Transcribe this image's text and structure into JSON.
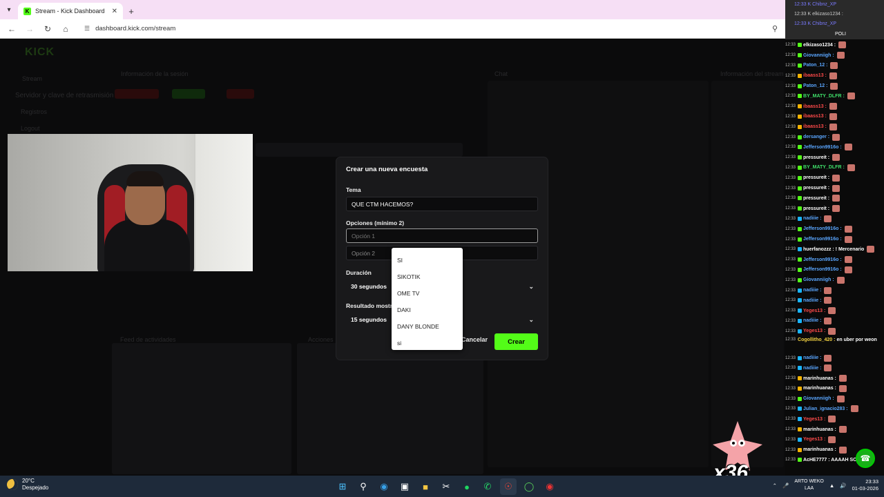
{
  "browser": {
    "tab_title": "Stream - Kick Dashboard",
    "tab_favicon": "K",
    "url": "dashboard.kick.com/stream"
  },
  "dashboard_bg": {
    "logo": "KICK",
    "nav_stream": "Stream",
    "nav_logs": "Registros",
    "nav_logout": "Logout",
    "stream_info": "Información de la sesión",
    "chat": "Chat",
    "stream_title": "Servidor y clave de retrasmisión",
    "activity_feed": "Feed de actividades",
    "actions": "Acciones",
    "stream_info_right": "Información del stream"
  },
  "modal": {
    "title": "Crear una nueva encuesta",
    "topic_label": "Tema",
    "topic_value": "QUE CTM HACEMOS?",
    "options_label": "Opciones (mínimo 2)",
    "option1_placeholder": "Opción 1",
    "option2_placeholder": "Opción 2",
    "duration_label": "Duración",
    "duration_value": "30 segundos",
    "result_label": "Resultado mostr",
    "result_value": "15 segundos",
    "cancel": "Cancelar",
    "create": "Crear"
  },
  "autocomplete": [
    "SI",
    "SIKOTIK",
    "OME TV",
    "DAKI",
    "DANY BLONDE",
    "si"
  ],
  "chat_overlay": {
    "top_lines": [
      "12:33 K  Chibnz_XP",
      "12:33 K  elkizaso1234 :",
      "12:33 K  Chibnz_XP"
    ],
    "top_badge": "POLI",
    "messages": [
      {
        "time": "12:33",
        "user": "elkizaso1234 :",
        "color": "#ffffff",
        "badge": "g"
      },
      {
        "time": "12:33",
        "user": "Giovanniigh :",
        "color": "#5aa6ff",
        "badge": "g"
      },
      {
        "time": "12:33",
        "user": "Paton_12 :",
        "color": "#5aa6ff",
        "badge": "g"
      },
      {
        "time": "12:33",
        "user": "ibaass13 :",
        "color": "#ff4a4a",
        "badge": "y"
      },
      {
        "time": "12:33",
        "user": "Paton_12 :",
        "color": "#5aa6ff",
        "badge": "g"
      },
      {
        "time": "12:33",
        "user": "BY_MATY_DLFR :",
        "color": "#3fe06a",
        "badge": "g"
      },
      {
        "time": "12:33",
        "user": "ibaass13 :",
        "color": "#ff4a4a",
        "badge": "y"
      },
      {
        "time": "12:33",
        "user": "ibaass13 :",
        "color": "#ff4a4a",
        "badge": "y"
      },
      {
        "time": "12:33",
        "user": "ibaass13 :",
        "color": "#ff4a4a",
        "badge": "y"
      },
      {
        "time": "12:33",
        "user": "dersanger :",
        "color": "#5aa6ff",
        "badge": "g"
      },
      {
        "time": "12:33",
        "user": "Jefferson9916o :",
        "color": "#5aa6ff",
        "badge": "g"
      },
      {
        "time": "12:33",
        "user": "pressureit :",
        "color": "#ffffff",
        "badge": "g"
      },
      {
        "time": "12:33",
        "user": "BY_MATY_DLFR :",
        "color": "#3fe06a",
        "badge": "g"
      },
      {
        "time": "12:33",
        "user": "pressureit :",
        "color": "#ffffff",
        "badge": "g"
      },
      {
        "time": "12:33",
        "user": "pressureit :",
        "color": "#ffffff",
        "badge": "g"
      },
      {
        "time": "12:33",
        "user": "pressureit :",
        "color": "#ffffff",
        "badge": "g"
      },
      {
        "time": "12:33",
        "user": "pressureit :",
        "color": "#ffffff",
        "badge": "g"
      },
      {
        "time": "12:33",
        "user": "nadiiie :",
        "color": "#5aa6ff",
        "badge": "c"
      },
      {
        "time": "12:33",
        "user": "Jefferson9916o :",
        "color": "#5aa6ff",
        "badge": "g"
      },
      {
        "time": "12:33",
        "user": "Jefferson9916o :",
        "color": "#5aa6ff",
        "badge": "g"
      },
      {
        "time": "12:33",
        "user": "huerfanozzz : ! Mercenario",
        "color": "#ffffff",
        "badge": "c"
      },
      {
        "time": "12:33",
        "user": "Jefferson9916o :",
        "color": "#5aa6ff",
        "badge": "g"
      },
      {
        "time": "12:33",
        "user": "Jefferson9916o :",
        "color": "#5aa6ff",
        "badge": "g"
      },
      {
        "time": "12:33",
        "user": "Giovanniigh :",
        "color": "#5aa6ff",
        "badge": "g"
      },
      {
        "time": "12:33",
        "user": "nadiiie :",
        "color": "#5aa6ff",
        "badge": "c"
      },
      {
        "time": "12:33",
        "user": "nadiiie :",
        "color": "#5aa6ff",
        "badge": "c"
      },
      {
        "time": "12:33",
        "user": "Yeges13 :",
        "color": "#ff4a4a",
        "badge": "c"
      },
      {
        "time": "12:33",
        "user": "nadiiie :",
        "color": "#5aa6ff",
        "badge": "c"
      },
      {
        "time": "12:33",
        "user": "Yeges13 :",
        "color": "#ff4a4a",
        "badge": "c"
      }
    ],
    "wrapped_message": {
      "time": "12:33",
      "user": "Cogollitho_420 :",
      "text": "en uber por weon",
      "color": "#f5d442"
    },
    "messages2": [
      {
        "time": "12:33",
        "user": "nadiiie :",
        "color": "#5aa6ff",
        "badge": "c"
      },
      {
        "time": "12:33",
        "user": "nadiiie :",
        "color": "#5aa6ff",
        "badge": "c"
      },
      {
        "time": "12:33",
        "user": "marinhuanas :",
        "color": "#ffffff",
        "badge": "y"
      },
      {
        "time": "12:33",
        "user": "marinhuanas :",
        "color": "#ffffff",
        "badge": "y"
      },
      {
        "time": "12:33",
        "user": "Giovanniigh :",
        "color": "#5aa6ff",
        "badge": "g"
      },
      {
        "time": "12:33",
        "user": "Julian_ignacio283 :",
        "color": "#5aa6ff",
        "badge": "c"
      },
      {
        "time": "12:33",
        "user": "Yeges13 :",
        "color": "#ff4a4a",
        "badge": "c"
      },
      {
        "time": "12:33",
        "user": "marinhuanas :",
        "color": "#ffffff",
        "badge": "y"
      },
      {
        "time": "12:33",
        "user": "Yeges13 :",
        "color": "#ff4a4a",
        "badge": "c"
      },
      {
        "time": "12:33",
        "user": "marinhuanas :",
        "color": "#ffffff",
        "badge": "y"
      },
      {
        "time": "12:33",
        "user": "AcHE7777 : AAAAH SOY",
        "color": "#ffffff",
        "badge": "g"
      }
    ],
    "combo": "x36"
  },
  "taskbar": {
    "temperature": "20°C",
    "weather": "Despejado",
    "lang_top": "ARTO WEKO",
    "lang_bottom": "LAA",
    "time": "23:33",
    "date": "01-03-2026"
  }
}
